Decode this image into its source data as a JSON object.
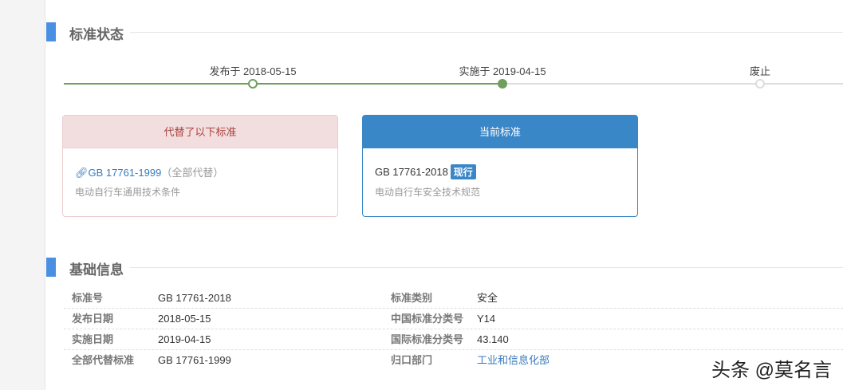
{
  "status_section": {
    "title": "标准状态"
  },
  "timeline": [
    {
      "label": "发布于 2018-05-15",
      "state": "done"
    },
    {
      "label": "实施于 2019-04-15",
      "state": "current"
    },
    {
      "label": "废止",
      "state": "pending"
    }
  ],
  "colors": {
    "accent": "#4a90e2",
    "progress": "#6f9e5e",
    "current": "#3a87c8",
    "replaced": "#f2dede"
  },
  "replaced_card": {
    "header": "代替了以下标准",
    "code": "GB 17761-1999",
    "note": "（全部代替）",
    "desc": "电动自行车通用技术条件"
  },
  "current_card": {
    "header": "当前标准",
    "code": "GB 17761-2018",
    "badge": "现行",
    "desc": "电动自行车安全技术规范"
  },
  "info_section": {
    "title": "基础信息"
  },
  "info_rows": [
    {
      "l1": "标准号",
      "v1": "GB 17761-2018",
      "l2": "标准类别",
      "v2": "安全"
    },
    {
      "l1": "发布日期",
      "v1": "2018-05-15",
      "l2": "中国标准分类号",
      "v2": "Y14"
    },
    {
      "l1": "实施日期",
      "v1": "2019-04-15",
      "l2": "国际标准分类号",
      "v2": "43.140"
    },
    {
      "l1": "全部代替标准",
      "v1": "GB 17761-1999",
      "l2": "归口部门",
      "v2": "工业和信息化部"
    }
  ],
  "watermark": "头条 @莫名言"
}
